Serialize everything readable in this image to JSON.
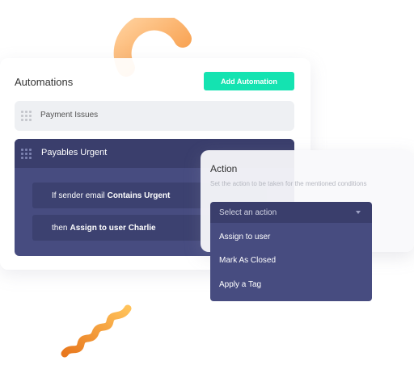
{
  "card": {
    "title": "Automations",
    "add_button_label": "Add Automation"
  },
  "rules": [
    {
      "label": "Payment Issues"
    },
    {
      "label": "Payables Urgent"
    }
  ],
  "conditions": [
    {
      "prefix": "If sender email",
      "emphasis": "Contains Urgent"
    },
    {
      "prefix": "then",
      "emphasis": "Assign to user Charlie"
    }
  ],
  "action": {
    "title": "Action",
    "subtitle": "Set the action to be taken for the mentioned conditions",
    "select_placeholder": "Select an action",
    "options": [
      "Assign to user",
      "Mark As Closed",
      "Apply a Tag"
    ]
  },
  "icons": {
    "drag_handle": "drag-handle-icon",
    "dropdown": "chevron-down-icon"
  },
  "colors": {
    "accent": "#14e3b1",
    "panel_dark": "#474c80",
    "panel_darker": "#3a3e6c",
    "decoration": "#f7a050"
  }
}
